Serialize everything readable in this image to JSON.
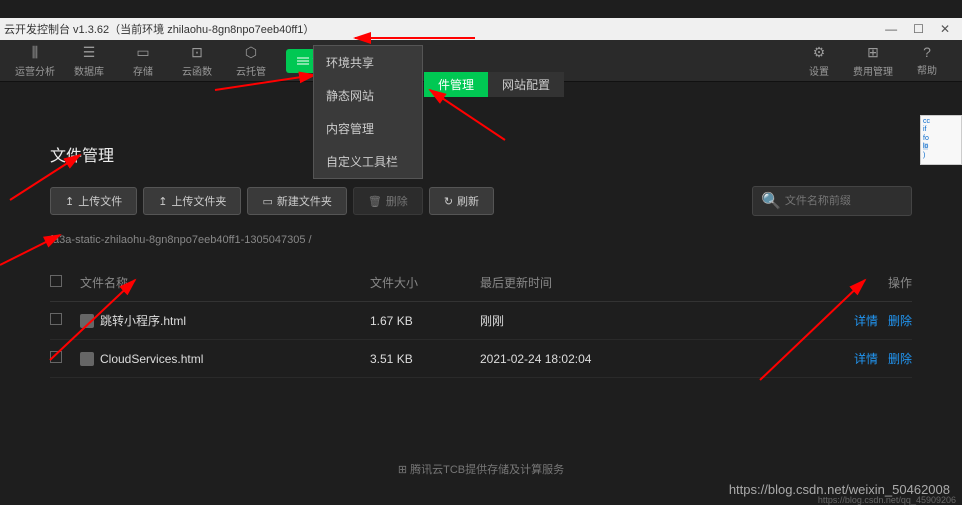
{
  "titlebar": {
    "text": "云开发控制台 v1.3.62（当前环境 zhilaohu-8gn8npo7eeb40ff1）"
  },
  "toolbar": {
    "items": [
      {
        "label": "运营分析"
      },
      {
        "label": "数据库"
      },
      {
        "label": "存储"
      },
      {
        "label": "云函数"
      },
      {
        "label": "云托管"
      }
    ],
    "right": [
      {
        "label": "设置"
      },
      {
        "label": "费用管理"
      },
      {
        "label": "帮助"
      }
    ]
  },
  "dropdown": {
    "items": [
      "环境共享",
      "静态网站",
      "内容管理",
      "自定义工具栏"
    ]
  },
  "tabs": {
    "active": "件管理",
    "other": "网站配置"
  },
  "page": {
    "title": "文件管理"
  },
  "buttons": {
    "upload_file": "上传文件",
    "upload_folder": "上传文件夹",
    "new_folder": "新建文件夹",
    "delete": "删除",
    "refresh": "刷新"
  },
  "search": {
    "placeholder": "文件名称前缀"
  },
  "breadcrumb": "fa3a-static-zhilaohu-8gn8npo7eeb40ff1-1305047305 /",
  "table": {
    "headers": {
      "name": "文件名称",
      "size": "文件大小",
      "time": "最后更新时间",
      "actions": "操作"
    },
    "rows": [
      {
        "name": "跳转小程序.html",
        "size": "1.67 KB",
        "time": "刚刚"
      },
      {
        "name": "CloudServices.html",
        "size": "3.51 KB",
        "time": "2021-02-24 18:02:04"
      }
    ],
    "action_detail": "详情",
    "action_delete": "删除"
  },
  "footer": "腾讯云TCB提供存储及计算服务",
  "watermark": "https://blog.csdn.net/weixin_50462008",
  "watermark2": "https://blog.csdn.net/qq_45909206"
}
